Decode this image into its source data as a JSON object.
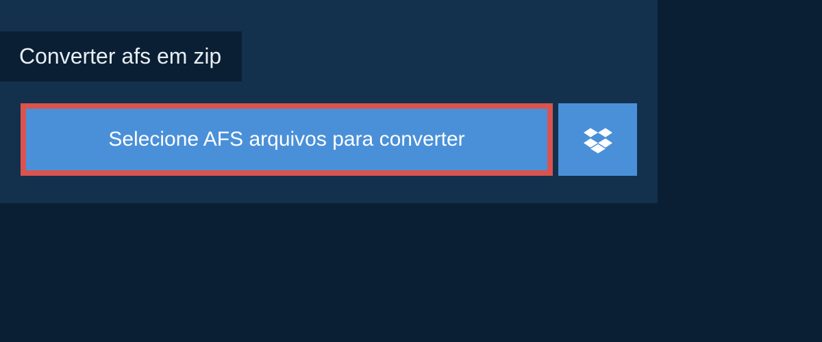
{
  "tab": {
    "title": "Converter afs em zip"
  },
  "buttons": {
    "select_label": "Selecione AFS arquivos para converter",
    "dropbox_icon": "dropbox-icon"
  },
  "colors": {
    "page_bg": "#0a1f33",
    "panel_bg": "#13304d",
    "button_bg": "#4a90d9",
    "highlight_border": "#d9534f",
    "text_light": "#ffffff"
  }
}
